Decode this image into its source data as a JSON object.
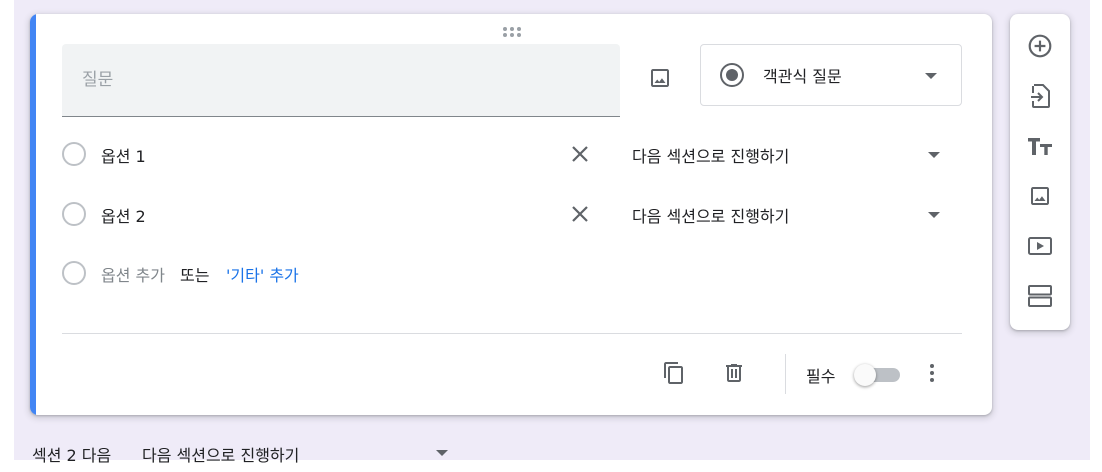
{
  "question": {
    "placeholder": "질문",
    "type_label": "객관식 질문"
  },
  "options": [
    {
      "label": "옵션 1",
      "goto": "다음 섹션으로 진행하기"
    },
    {
      "label": "옵션 2",
      "goto": "다음 섹션으로 진행하기"
    }
  ],
  "add_row": {
    "add_option": "옵션 추가",
    "or": "또는",
    "add_other": "'기타' 추가"
  },
  "footer": {
    "required_label": "필수",
    "required_on": false
  },
  "section_footer": {
    "after_label": "섹션 2 다음",
    "goto_label": "다음 섹션으로 진행하기"
  },
  "colors": {
    "accent": "#4285f4",
    "link": "#1a73e8",
    "background": "#efebf8"
  },
  "icons": {
    "drag": "drag-handle-icon",
    "image": "image-icon",
    "radio": "radio-checked-icon",
    "close": "close-icon",
    "copy": "copy-icon",
    "trash": "trash-icon",
    "more": "more-vert-icon",
    "toolbar": [
      "add-circle-icon",
      "import-icon",
      "title-icon",
      "image-icon",
      "video-icon",
      "section-icon"
    ]
  }
}
